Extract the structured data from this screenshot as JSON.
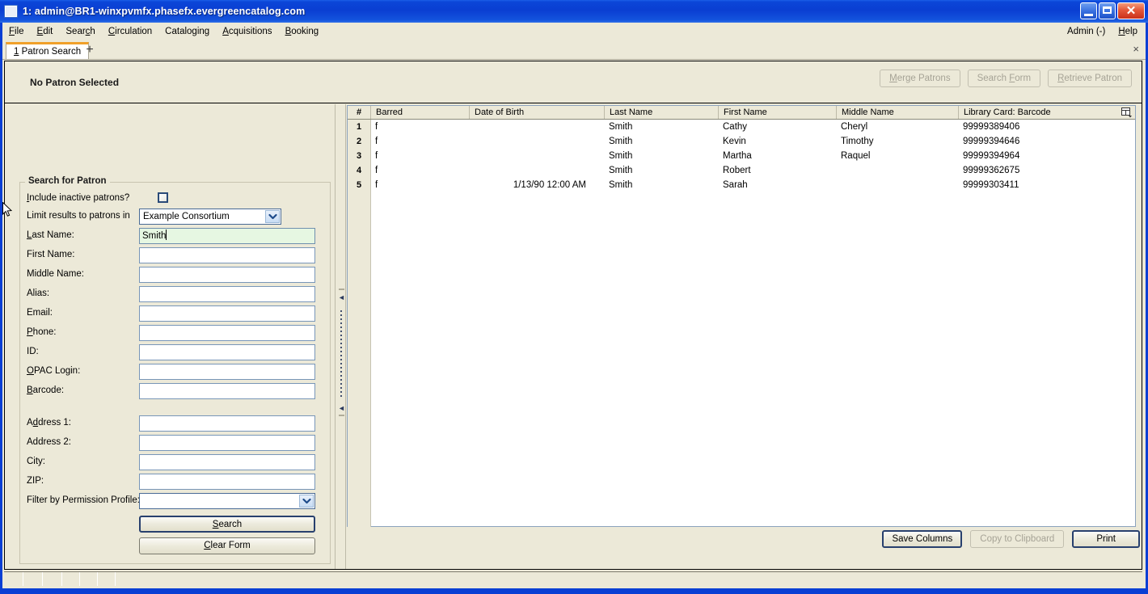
{
  "window": {
    "title": "1: admin@BR1-winxpvmfx.phasefx.evergreencatalog.com",
    "app_icon": "window-icon",
    "minimize_label": "",
    "maximize_label": "",
    "close_label": "✕"
  },
  "menubar": {
    "items": [
      {
        "label": "File",
        "accel": "F"
      },
      {
        "label": "Edit",
        "accel": "E"
      },
      {
        "label": "Search",
        "accel": "c"
      },
      {
        "label": "Circulation",
        "accel": "C"
      },
      {
        "label": "Cataloging",
        "accel": "g"
      },
      {
        "label": "Acquisitions",
        "accel": "A"
      },
      {
        "label": "Booking",
        "accel": "B"
      }
    ],
    "right_items": [
      {
        "label": "Admin (-)",
        "accel": ""
      },
      {
        "label": "Help",
        "accel": "H"
      }
    ]
  },
  "tabs": {
    "items": [
      {
        "number": "1",
        "label": "Patron Search"
      }
    ],
    "new_tab_label": "+",
    "close_label": "×"
  },
  "patron_bar": {
    "title": "No Patron Selected",
    "buttons": [
      {
        "label": "Merge Patrons",
        "enabled": false
      },
      {
        "label": "Search Form",
        "enabled": false
      },
      {
        "label": "Retrieve Patron",
        "enabled": false
      }
    ]
  },
  "search_form": {
    "legend": "Search for Patron",
    "fields": [
      {
        "label": "Include inactive patrons?",
        "type": "checkbox",
        "value": false
      },
      {
        "label": "Limit results to patrons in",
        "type": "select",
        "value": "Example Consortium"
      },
      {
        "label": "Last Name:",
        "type": "text",
        "value": "Smith",
        "focused": true
      },
      {
        "label": "First Name:",
        "type": "text",
        "value": ""
      },
      {
        "label": "Middle Name:",
        "type": "text",
        "value": ""
      },
      {
        "label": "Alias:",
        "type": "text",
        "value": ""
      },
      {
        "label": "Email:",
        "type": "text",
        "value": ""
      },
      {
        "label": "Phone:",
        "type": "text",
        "value": ""
      },
      {
        "label": "ID:",
        "type": "text",
        "value": ""
      },
      {
        "label": "OPAC Login:",
        "type": "text",
        "value": ""
      },
      {
        "label": "Barcode:",
        "type": "text",
        "value": ""
      },
      {
        "label": "Address 1:",
        "type": "text",
        "value": ""
      },
      {
        "label": "Address 2:",
        "type": "text",
        "value": ""
      },
      {
        "label": "City:",
        "type": "text",
        "value": ""
      },
      {
        "label": "ZIP:",
        "type": "text",
        "value": ""
      },
      {
        "label": "Filter by Permission Profile:",
        "type": "select",
        "value": ""
      }
    ],
    "search_button": "Search",
    "clear_button": "Clear Form"
  },
  "results": {
    "columns": [
      "#",
      "Barred",
      "Date of Birth",
      "Last Name",
      "First Name",
      "Middle Name",
      "Library Card: Barcode"
    ],
    "column_picker_icon": "column-picker-icon",
    "rows": [
      {
        "num": "1",
        "barred": "f",
        "dob": "",
        "last": "Smith",
        "first": "Cathy",
        "middle": "Cheryl",
        "barcode": "99999389406"
      },
      {
        "num": "2",
        "barred": "f",
        "dob": "",
        "last": "Smith",
        "first": "Kevin",
        "middle": "Timothy",
        "barcode": "99999394646"
      },
      {
        "num": "3",
        "barred": "f",
        "dob": "",
        "last": "Smith",
        "first": "Martha",
        "middle": "Raquel",
        "barcode": "99999394964"
      },
      {
        "num": "4",
        "barred": "f",
        "dob": "",
        "last": "Smith",
        "first": "Robert",
        "middle": "",
        "barcode": "99999362675"
      },
      {
        "num": "5",
        "barred": "f",
        "dob": "1/13/90 12:00 AM",
        "last": "Smith",
        "first": "Sarah",
        "middle": "",
        "barcode": "99999303411"
      }
    ],
    "footer_buttons": [
      {
        "label": "Save Columns",
        "enabled": true
      },
      {
        "label": "Copy to Clipboard",
        "enabled": false
      },
      {
        "label": "Print",
        "enabled": true
      }
    ]
  },
  "colors": {
    "titlebar_blue": "#0a3ed2",
    "face": "#ece9d8",
    "tab_accent": "#f0a02a",
    "focused_field": "#e6f7e2"
  }
}
